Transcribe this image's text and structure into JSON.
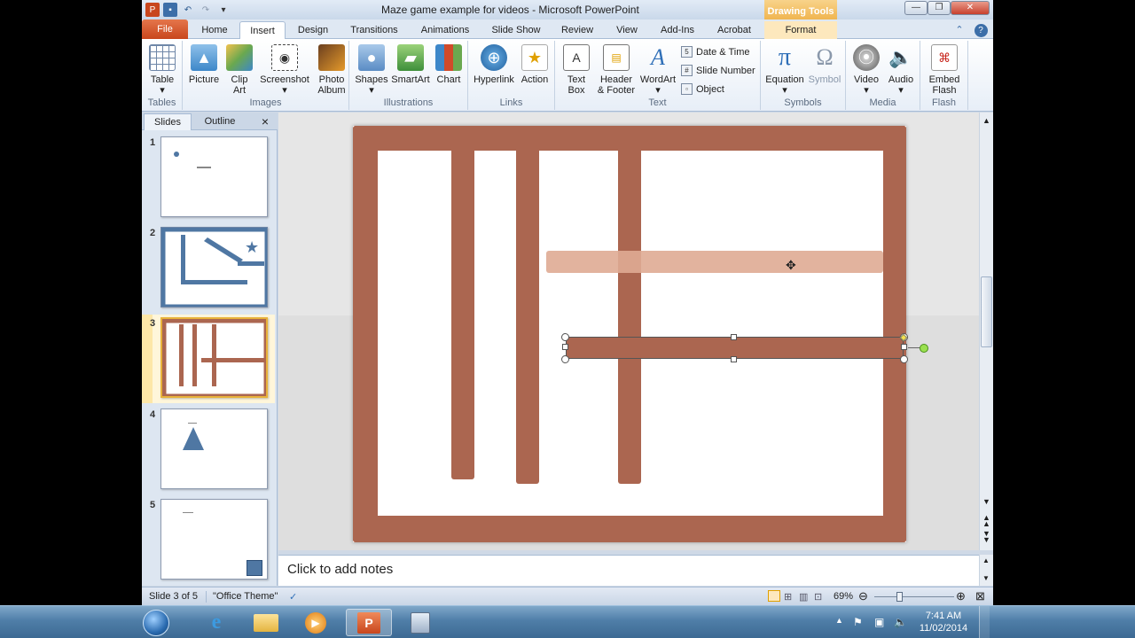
{
  "window": {
    "title": "Maze game example for videos - Microsoft PowerPoint",
    "contextual_tab_header": "Drawing Tools",
    "controls": [
      "minimize",
      "restore",
      "close"
    ]
  },
  "tabs": [
    "File",
    "Home",
    "Insert",
    "Design",
    "Transitions",
    "Animations",
    "Slide Show",
    "Review",
    "View",
    "Add-Ins",
    "Acrobat",
    "Format"
  ],
  "active_tab": "Insert",
  "ribbon": {
    "groups": {
      "tables": "Tables",
      "images": "Images",
      "illustrations": "Illustrations",
      "links": "Links",
      "text": "Text",
      "symbols": "Symbols",
      "media": "Media",
      "flash": "Flash"
    },
    "table": "Table",
    "picture": "Picture",
    "clip_art_1": "Clip",
    "clip_art_2": "Art",
    "screenshot": "Screenshot",
    "photo_album_1": "Photo",
    "photo_album_2": "Album",
    "shapes": "Shapes",
    "smartart": "SmartArt",
    "chart": "Chart",
    "hyperlink": "Hyperlink",
    "action": "Action",
    "text_box_1": "Text",
    "text_box_2": "Box",
    "header_footer_1": "Header",
    "header_footer_2": "& Footer",
    "wordart": "WordArt",
    "date_time": "Date & Time",
    "slide_number": "Slide Number",
    "object": "Object",
    "equation": "Equation",
    "symbol": "Symbol",
    "video": "Video",
    "audio": "Audio",
    "embed_flash_1": "Embed",
    "embed_flash_2": "Flash"
  },
  "panel": {
    "tab_slides": "Slides",
    "tab_outline": "Outline",
    "close": "×",
    "slide_numbers": [
      "1",
      "2",
      "3",
      "4",
      "5"
    ],
    "selected_slide": 3
  },
  "notes_placeholder": "Click to add notes",
  "status": {
    "slide_info": "Slide 3 of 5",
    "theme": "\"Office Theme\"",
    "zoom": "69%"
  },
  "taskbar": {
    "time": "7:41 AM",
    "date": "11/02/2014",
    "apps": [
      "start",
      "internet-explorer",
      "windows-explorer",
      "media-player",
      "powerpoint",
      "other-app"
    ]
  },
  "colors": {
    "maze_wall": "#ab6650",
    "maze_wall_faded": "#dfab93",
    "slide2_color": "#4f77a3",
    "file_tab": "#d0532a",
    "drawing_tools": "#f0b550"
  }
}
